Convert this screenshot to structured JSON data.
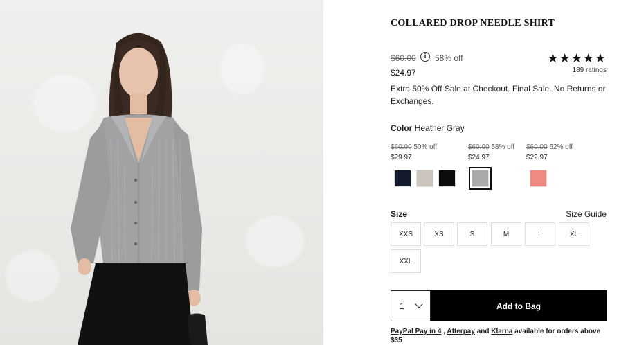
{
  "product": {
    "title": "COLLARED DROP NEEDLE SHIRT",
    "price_original": "$60.00",
    "discount": "58% off",
    "price_current": "$24.97",
    "rating_stars": "★★★★★",
    "rating_value": 4.5,
    "ratings_link": "189 ratings",
    "promo_text": "Extra 50% Off Sale at Checkout. Final Sale. No Returns or Exchanges."
  },
  "color": {
    "label": "Color",
    "selected_name": "Heather Gray",
    "price_groups": [
      {
        "old": "$60.00",
        "pct": "50% off",
        "now": "$29.97"
      },
      {
        "old": "$60.00",
        "pct": "58% off",
        "now": "$24.97"
      },
      {
        "old": "$60.00",
        "pct": "62% off",
        "now": "$22.97"
      }
    ],
    "swatches": [
      {
        "name": "navy",
        "color": "#141a2e"
      },
      {
        "name": "oatmeal",
        "color": "#cbc4bd"
      },
      {
        "name": "black",
        "color": "#0d0d0d"
      },
      {
        "name": "heather-gray",
        "color": "#a9abab",
        "selected": true
      },
      {
        "name": "coral",
        "color": "#f08a80"
      }
    ]
  },
  "size": {
    "label": "Size",
    "guide_link": "Size Guide",
    "options": [
      "XXS",
      "XS",
      "S",
      "M",
      "L",
      "XL",
      "XXL"
    ]
  },
  "cart": {
    "qty": "1",
    "add_label": "Add to Bag"
  },
  "payments": {
    "paypal": "PayPal Pay in 4",
    "comma": " , ",
    "afterpay": "Afterpay",
    "and": " and ",
    "klarna": "Klarna",
    "tail": " available for orders above $35"
  }
}
